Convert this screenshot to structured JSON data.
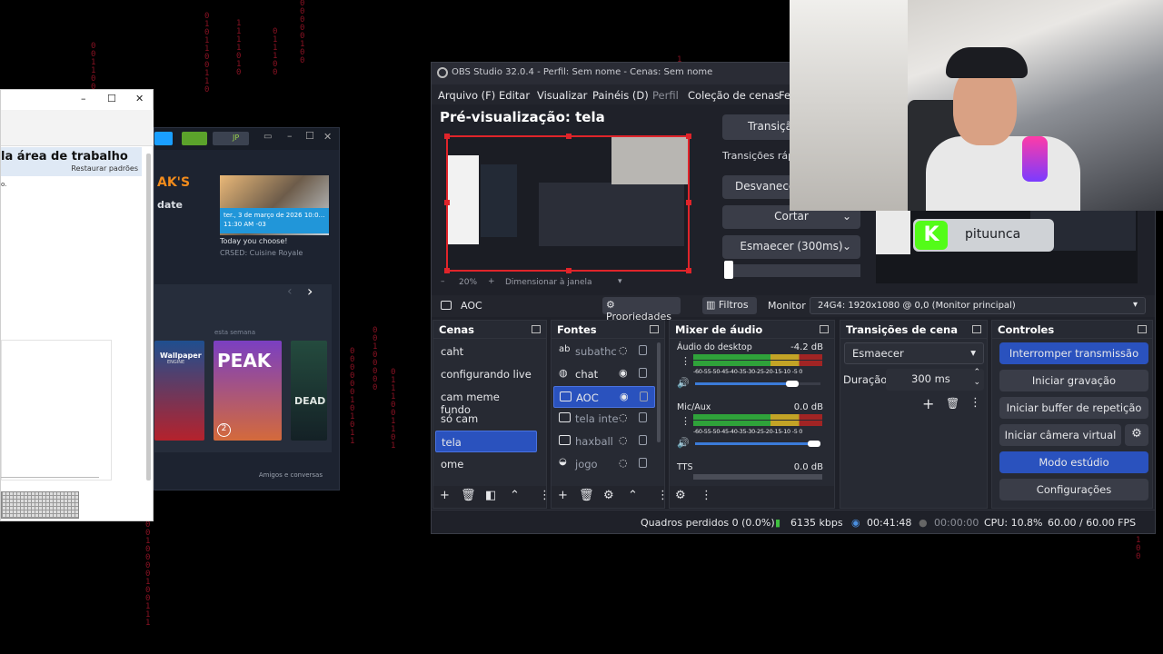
{
  "left_window": {
    "heading": "la área de trabalho",
    "restore": "Restaurar padrões",
    "small_text": "o.",
    "minimize": "–",
    "maximize": "☐",
    "close": "✕"
  },
  "steam": {
    "user_badge": "JP",
    "logo_text": "AK'S",
    "subtitle": "date",
    "event_date": "ter., 3 de março de 2026 10:0…",
    "event_time": "11:30 AM -03",
    "choose": "Today you choose!",
    "crsed": "CRSED: Cuisine Royale",
    "week_label": "esta semana",
    "card_labels": [
      "Wallpaper",
      "ENGINE",
      "PEAK",
      "DEAD"
    ],
    "peak_badge": "2",
    "friends": "Amigos e conversas"
  },
  "obs": {
    "title": "OBS Studio 32.0.4 - Perfil: Sem nome - Cenas: Sem nome",
    "menu": [
      "Arquivo (F)",
      "Editar",
      "Visualizar",
      "Painéis (D)",
      "Perfil",
      "Coleção de cenas",
      "Fe"
    ],
    "preview_title": "Pré-visualização: tela",
    "zoom": "20%",
    "zoom_mode": "Dimensionar à janela",
    "transition_btn": "Transiçã",
    "quick_transitions": "Transições ráp",
    "fade_btn": "Desvanecer",
    "cut_btn": "Cortar",
    "fade300_btn": "Esmaecer (300ms)",
    "source_bar": {
      "name": "AOC",
      "properties": "Propriedades",
      "filters": "Filtros",
      "monitor_label": "Monitor",
      "monitor_value": "24G4: 1920x1080 @ 0,0 (Monitor principal)"
    },
    "scenes": {
      "title": "Cenas",
      "items": [
        "caht",
        "configurando live",
        "cam meme fundo",
        "só cam",
        "tela",
        "ome"
      ],
      "selected": 4
    },
    "sources": {
      "title": "Fontes",
      "items": [
        "subathc",
        "chat",
        "AOC",
        "tela inte",
        "haxball",
        "jogo"
      ],
      "selected": 2
    },
    "mixer": {
      "title": "Mixer de áudio",
      "ticks": "-60-55-50-45-40-35-30-25-20-15-10 -5  0",
      "channels": [
        {
          "name": "Áudio do desktop",
          "db": "-4.2 dB",
          "level": 0.93
        },
        {
          "name": "Mic/Aux",
          "db": "0.0 dB",
          "level": 1.0
        },
        {
          "name": "TTS",
          "db": "0.0 dB",
          "level": 0.0
        }
      ]
    },
    "transitions": {
      "title": "Transições de cena",
      "selected": "Esmaecer",
      "duration_label": "Duração",
      "duration_value": "300 ms"
    },
    "controls": {
      "title": "Controles",
      "buttons": [
        "Interromper transmissão",
        "Iniciar gravação",
        "Iniciar buffer de repetição",
        "Iniciar câmera virtual",
        "Modo estúdio",
        "Configurações"
      ]
    },
    "status": {
      "dropped": "Quadros perdidos 0 (0.0%)",
      "bitrate": "6135 kbps",
      "stream_time": "00:41:48",
      "rec_time": "00:00:00",
      "cpu": "CPU: 10.8%",
      "fps": "60.00 / 60.00 FPS"
    }
  },
  "overlay": {
    "banner_letter": "K",
    "banner_name": "pituunca"
  },
  "colors": {
    "accent_blue": "#2a52be",
    "preview_border": "#e0242a",
    "matrix": "#a1162a",
    "kick_green": "#53fc18"
  }
}
